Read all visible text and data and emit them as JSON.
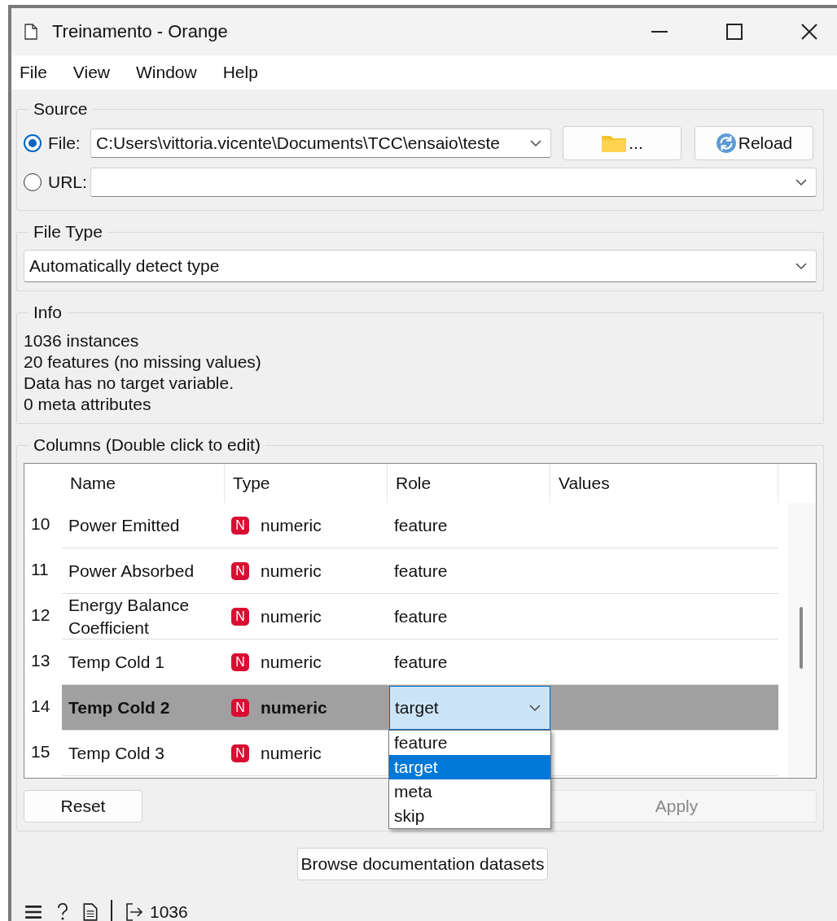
{
  "window": {
    "title": "Treinamento - Orange"
  },
  "menu": [
    {
      "label": "File"
    },
    {
      "label": "View"
    },
    {
      "label": "Window"
    },
    {
      "label": "Help"
    }
  ],
  "source": {
    "title": "Source",
    "options": [
      {
        "label": "File:",
        "selected": true,
        "value": "C:Users\\vittoria.vicente\\Documents\\TCC\\ensaio\\teste"
      },
      {
        "label": "URL:",
        "selected": false
      }
    ],
    "browse_button": "...",
    "reload_button": "Reload"
  },
  "file_type": {
    "title": "File Type",
    "value": "Automatically detect type"
  },
  "info": {
    "title": "Info",
    "lines": [
      "1036 instances",
      "20 features (no missing values)",
      "Data has no target variable.",
      "0 meta attributes"
    ]
  },
  "columns": {
    "title": "Columns (Double click to edit)",
    "headers": [
      "Name",
      "Type",
      "Role",
      "Values"
    ],
    "rows": [
      {
        "index": "10",
        "name": "Power Emitted",
        "type_badge": "N",
        "type": "numeric",
        "role": "feature",
        "selected": false
      },
      {
        "index": "11",
        "name": "Power Absorbed",
        "type_badge": "N",
        "type": "numeric",
        "role": "feature",
        "selected": false
      },
      {
        "index": "12",
        "name": "Energy Balance Coefficient",
        "type_badge": "N",
        "type": "numeric",
        "role": "feature",
        "selected": false
      },
      {
        "index": "13",
        "name": "Temp Cold 1",
        "type_badge": "N",
        "type": "numeric",
        "role": "feature",
        "selected": false
      },
      {
        "index": "14",
        "name": "Temp Cold 2",
        "type_badge": "N",
        "type": "numeric",
        "role": "target",
        "selected": true
      },
      {
        "index": "15",
        "name": "Temp Cold 3",
        "type_badge": "N",
        "type": "numeric",
        "selected": false
      }
    ],
    "dropdown": [
      {
        "label": "feature",
        "selected": false
      },
      {
        "label": "target",
        "selected": true
      },
      {
        "label": "meta",
        "selected": false
      },
      {
        "label": "skip",
        "selected": false
      }
    ]
  },
  "buttons": [
    {
      "label": "Reset",
      "disabled": false
    },
    {
      "label": "Apply",
      "disabled": true
    }
  ],
  "browse_docs_button": "Browse documentation datasets",
  "status_bar": {
    "output_count": "1036"
  }
}
